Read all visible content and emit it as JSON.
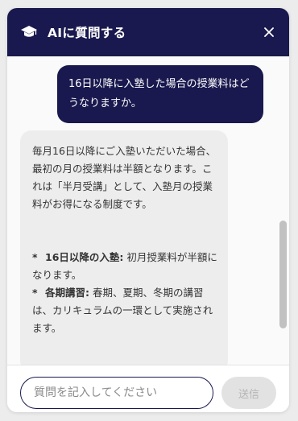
{
  "header": {
    "title": "AIに質問する",
    "icon": "graduation-cap-icon",
    "close_icon": "close-icon",
    "bg_color": "#19194f"
  },
  "messages": {
    "user": "16日以降に入塾した場合の授業料はどうなりますか。",
    "bot": {
      "intro": "毎月16日以降にご入塾いただいた場合、最初の月の授業料は半額となります。これは「半月受講」として、入塾月の授業料がお得になる制度です。",
      "bullets": [
        {
          "marker": "*",
          "label": "16日以降の入塾:",
          "text": "初月授業料が半額になります。"
        },
        {
          "marker": "*",
          "label": "各期講習:",
          "text": "春期、夏期、冬期の講習は、カリキュラムの一環として実施されます。"
        }
      ]
    }
  },
  "input": {
    "placeholder": "質問を記入してください",
    "value": ""
  },
  "send_button": {
    "label": "送信"
  }
}
